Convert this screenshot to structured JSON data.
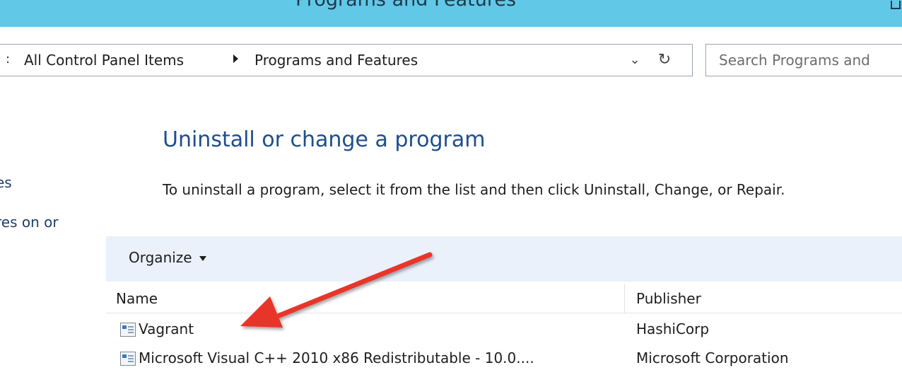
{
  "window": {
    "title": "Programs and Features"
  },
  "address_bar": {
    "breadcrumb_overflow": ":",
    "breadcrumb": [
      "All Control Panel Items",
      "Programs and Features"
    ]
  },
  "search": {
    "placeholder": "Search Programs and"
  },
  "left_pane": {
    "items": [
      "es",
      "res on or"
    ]
  },
  "main": {
    "heading": "Uninstall or change a program",
    "instructions": "To uninstall a program, select it from the list and then click Uninstall, Change, or Repair."
  },
  "toolbar": {
    "organize_label": "Organize"
  },
  "table": {
    "columns": [
      "Name",
      "Publisher"
    ],
    "rows": [
      {
        "name": "Vagrant",
        "publisher": "HashiCorp"
      },
      {
        "name": "Microsoft Visual C++ 2010  x86 Redistributable - 10.0....",
        "publisher": "Microsoft Corporation"
      }
    ]
  },
  "annotation": {
    "color": "#e8352b"
  },
  "colors": {
    "titlebar": "#62c8e8",
    "heading": "#1e4e8c",
    "toolbar": "#eaf1fb"
  }
}
